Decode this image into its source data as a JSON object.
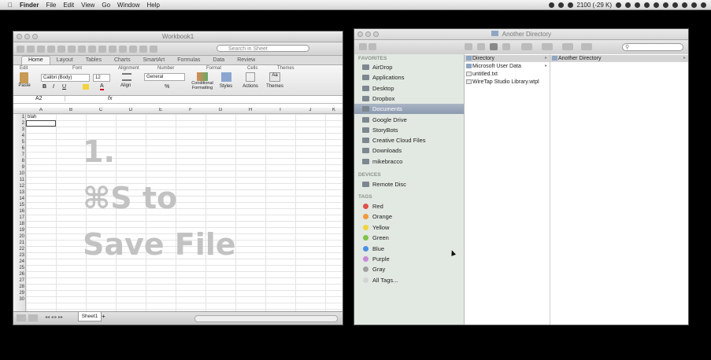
{
  "menubar": {
    "apple": "",
    "app": "Finder",
    "items": [
      "File",
      "Edit",
      "View",
      "Go",
      "Window",
      "Help"
    ],
    "battery": "2100 (-29 K)"
  },
  "excel": {
    "title": "Workbook1",
    "search_placeholder": "Search in Sheet",
    "tabs": [
      "Home",
      "Layout",
      "Tables",
      "Charts",
      "SmartArt",
      "Formulas",
      "Data",
      "Review"
    ],
    "groups": [
      "Edit",
      "Font",
      "Alignment",
      "Number",
      "Format",
      "Cells",
      "Themes"
    ],
    "paste_label": "Paste",
    "font_name": "Calibri (Body)",
    "font_size": "12",
    "number_format": "General",
    "align_label": "Align",
    "cond_format_label": "Conditional Formatting",
    "styles_label": "Styles",
    "actions_label": "Actions",
    "themes_label": "Themes",
    "cell_ref": "A2",
    "fx": "fx",
    "columns": [
      "A",
      "B",
      "C",
      "D",
      "E",
      "F",
      "G",
      "H",
      "I",
      "J",
      "K"
    ],
    "rows": [
      "1",
      "2",
      "3",
      "4",
      "5",
      "6",
      "7",
      "8",
      "9",
      "10",
      "11",
      "12",
      "13",
      "14",
      "15",
      "16",
      "17",
      "18",
      "19",
      "20",
      "21",
      "22",
      "23",
      "24",
      "25",
      "26",
      "27",
      "28",
      "29",
      "30"
    ],
    "cell_a1": "blah",
    "sheet_tab": "Sheet1",
    "overlay_line1": "1.",
    "overlay_line2": "⌘S to",
    "overlay_line3": "Save File"
  },
  "finder": {
    "title": "Another Directory",
    "search_placeholder": "",
    "favorites_header": "FAVORITES",
    "favorites": [
      {
        "label": "AirDrop",
        "icon": "airdrop-icon"
      },
      {
        "label": "Applications",
        "icon": "applications-icon"
      },
      {
        "label": "Desktop",
        "icon": "desktop-icon"
      },
      {
        "label": "Dropbox",
        "icon": "dropbox-icon"
      },
      {
        "label": "Documents",
        "icon": "documents-icon",
        "selected": true
      },
      {
        "label": "Google Drive",
        "icon": "folder-icon"
      },
      {
        "label": "StoryBots",
        "icon": "folder-icon"
      },
      {
        "label": "Creative Cloud Files",
        "icon": "creative-cloud-icon"
      },
      {
        "label": "Downloads",
        "icon": "downloads-icon"
      },
      {
        "label": "mikebracco",
        "icon": "home-icon"
      }
    ],
    "devices_header": "DEVICES",
    "devices": [
      {
        "label": "Remote Disc",
        "icon": "disc-icon"
      }
    ],
    "tags_header": "TAGS",
    "tags": [
      {
        "label": "Red",
        "color": "#e0504a"
      },
      {
        "label": "Orange",
        "color": "#f09a3a"
      },
      {
        "label": "Yellow",
        "color": "#f1d43c"
      },
      {
        "label": "Green",
        "color": "#7ec34a"
      },
      {
        "label": "Blue",
        "color": "#4a90e2"
      },
      {
        "label": "Purple",
        "color": "#c78ad6"
      },
      {
        "label": "Gray",
        "color": "#a0a0a0"
      },
      {
        "label": "All Tags...",
        "color": "#d4d4d4"
      }
    ],
    "column1": [
      {
        "label": "Directory",
        "selected": true,
        "arrow": "▸"
      },
      {
        "label": "Microsoft User Data",
        "arrow": "▸"
      },
      {
        "label": "untitled.txt"
      },
      {
        "label": "WireTap Studio Library.wtpl"
      }
    ],
    "column2": [
      {
        "label": "Another Directory",
        "selected": true,
        "arrow": "▸"
      }
    ]
  }
}
